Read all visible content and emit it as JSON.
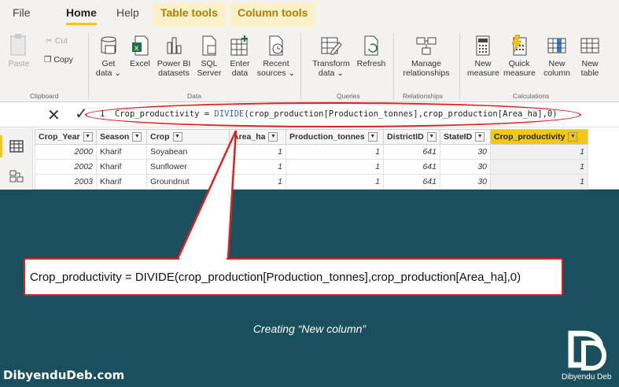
{
  "ribbon": {
    "tabs": [
      "File",
      "Home",
      "Help",
      "Table tools",
      "Column tools"
    ],
    "clipboard": {
      "paste": "Paste",
      "cut": "Cut",
      "copy": "Copy",
      "group": "Clipboard"
    },
    "data": {
      "get_data": [
        "Get",
        "data ⌄"
      ],
      "excel": "Excel",
      "powerbi": [
        "Power BI",
        "datasets"
      ],
      "sql": [
        "SQL",
        "Server"
      ],
      "enter": [
        "Enter",
        "data"
      ],
      "recent": [
        "Recent",
        "sources ⌄"
      ],
      "group": "Data"
    },
    "queries": {
      "transform": [
        "Transform",
        "data ⌄"
      ],
      "refresh": "Refresh",
      "group": "Queries"
    },
    "relationships": {
      "manage": [
        "Manage",
        "relationships"
      ],
      "group": "Relationships"
    },
    "calculations": {
      "new_measure": [
        "New",
        "measure"
      ],
      "quick_measure": [
        "Quick",
        "measure"
      ],
      "new_column": [
        "New",
        "column"
      ],
      "new_table": [
        "New",
        "table"
      ],
      "group": "Calculations"
    }
  },
  "formula_bar": {
    "line": "1",
    "prefix": "Crop_productivity = ",
    "function": "DIVIDE",
    "suffix": "(crop_production[Production_tonnes],crop_production[Area_ha],0)"
  },
  "table": {
    "columns": [
      "Crop_Year",
      "Season",
      "Crop",
      "Area_ha",
      "Production_tonnes",
      "DistrictID",
      "StateID",
      "Crop_productivity"
    ],
    "rows": [
      [
        "2000",
        "Kharif",
        "Soyabean",
        "1",
        "1",
        "641",
        "30",
        "1"
      ],
      [
        "2002",
        "Kharif",
        "Sunflower",
        "1",
        "1",
        "641",
        "30",
        "1"
      ],
      [
        "2003",
        "Kharif",
        "Groundnut",
        "1",
        "1",
        "641",
        "30",
        "1"
      ]
    ]
  },
  "callout": {
    "text": "Crop_productivity = DIVIDE(crop_production[Production_tonnes],crop_production[Area_ha],0)"
  },
  "caption": "Creating “New column”",
  "footer": {
    "site": "DibyenduDeb.com",
    "logo_name": "Dibyendu Deb"
  },
  "colors": {
    "background": "#1a4f5e",
    "accent": "#f2c811",
    "highlight": "#e02020"
  },
  "icons": [
    "paste-icon",
    "cut-icon",
    "copy-icon",
    "get-data-icon",
    "excel-icon",
    "powerbi-icon",
    "sql-icon",
    "enter-data-icon",
    "recent-sources-icon",
    "transform-icon",
    "refresh-icon",
    "manage-relationships-icon",
    "new-measure-icon",
    "quick-measure-icon",
    "new-column-icon",
    "new-table-icon",
    "report-view-icon",
    "data-view-icon",
    "model-view-icon",
    "close-icon",
    "check-icon"
  ]
}
